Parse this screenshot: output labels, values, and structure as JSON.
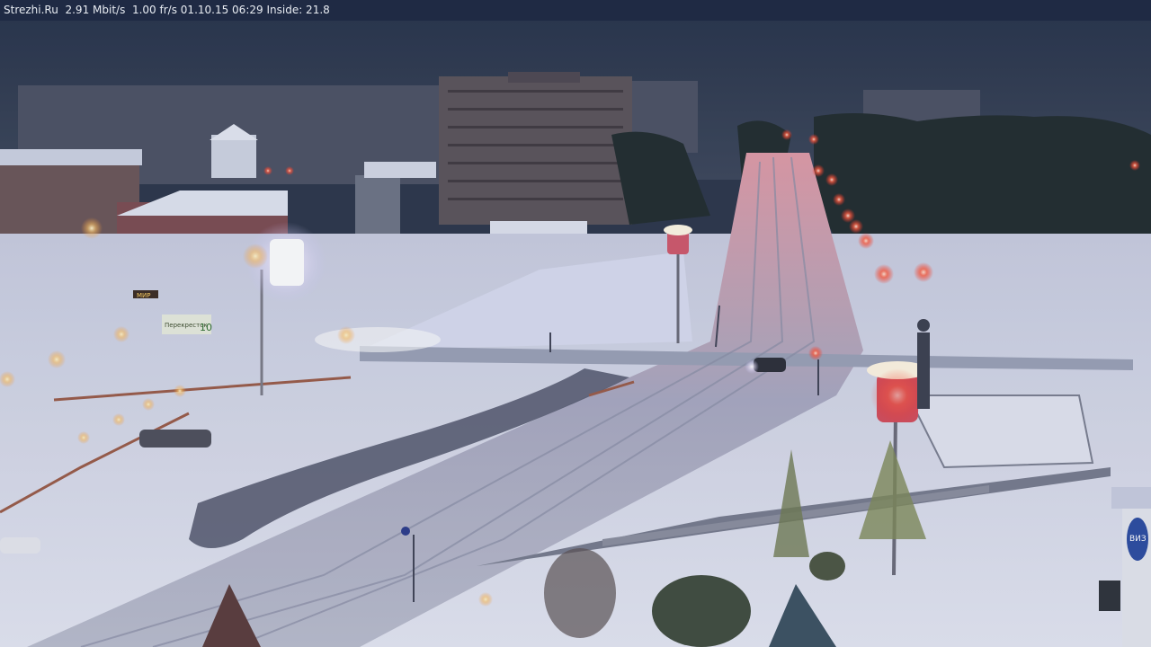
{
  "overlay": {
    "site": "Strezhi.Ru",
    "bitrate": "2.91 Mbit/s",
    "framerate": "1.00 fr/s",
    "datetime": "01.10.15 06:29",
    "inside": "Inside: 21.8"
  },
  "colors": {
    "sky": "#2c3548",
    "snow": "#d8dcea",
    "road": "#a9aec2",
    "trees": "#1f2a2a",
    "lamp": "#ff5040",
    "light": "#ffffff"
  },
  "signage": {
    "sign1": "Перекресток",
    "sign2": "10",
    "shop": "МИР",
    "totem": "ВИЗ"
  }
}
